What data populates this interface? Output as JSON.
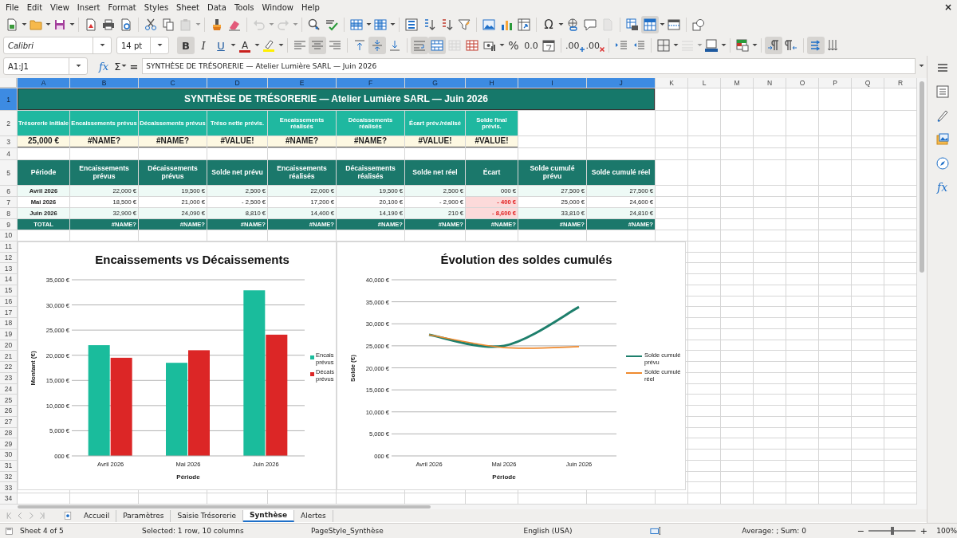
{
  "menu": [
    "File",
    "Edit",
    "View",
    "Insert",
    "Format",
    "Styles",
    "Sheet",
    "Data",
    "Tools",
    "Window",
    "Help"
  ],
  "close_label": "×",
  "toolbar": [
    {
      "kind": "new",
      "dropdown": true
    },
    {
      "kind": "open",
      "dropdown": true
    },
    {
      "kind": "save",
      "dropdown": true
    },
    {
      "kind": "sep"
    },
    {
      "kind": "pdf"
    },
    {
      "kind": "print"
    },
    {
      "kind": "preview"
    },
    {
      "kind": "sep"
    },
    {
      "kind": "cut"
    },
    {
      "kind": "copy"
    },
    {
      "kind": "paste",
      "dropdown": true,
      "disabled": true
    },
    {
      "kind": "sep"
    },
    {
      "kind": "clone"
    },
    {
      "kind": "clearformat"
    },
    {
      "kind": "sep"
    },
    {
      "kind": "undo",
      "dropdown": true,
      "disabled": true
    },
    {
      "kind": "redo",
      "dropdown": true,
      "disabled": true
    },
    {
      "kind": "sep"
    },
    {
      "kind": "findreplace"
    },
    {
      "kind": "spelling"
    },
    {
      "kind": "sep"
    },
    {
      "kind": "row",
      "dropdown": true
    },
    {
      "kind": "column",
      "dropdown": true
    },
    {
      "kind": "sep"
    },
    {
      "kind": "sort"
    },
    {
      "kind": "sortasc"
    },
    {
      "kind": "sortdesc"
    },
    {
      "kind": "filter"
    },
    {
      "kind": "sep"
    },
    {
      "kind": "image"
    },
    {
      "kind": "chart"
    },
    {
      "kind": "pivot"
    },
    {
      "kind": "sep"
    },
    {
      "kind": "special",
      "label": "Ω",
      "dropdown": true
    },
    {
      "kind": "hyperlink"
    },
    {
      "kind": "comment"
    },
    {
      "kind": "header",
      "disabled": true
    },
    {
      "kind": "sep"
    },
    {
      "kind": "printarea"
    },
    {
      "kind": "freeze",
      "dropdown": true,
      "pressed": true
    },
    {
      "kind": "split"
    },
    {
      "kind": "sep"
    },
    {
      "kind": "shapes"
    }
  ],
  "font_name": "Calibri",
  "font_size": "14 pt",
  "format_toolbar": [
    {
      "kind": "bold",
      "label": "B",
      "pressed": true
    },
    {
      "kind": "italic",
      "label": "I",
      "pressed": false
    },
    {
      "kind": "underline",
      "label": "U",
      "pressed": false,
      "dropdown": true
    },
    {
      "kind": "fontcolor",
      "label": "A",
      "dropdown": true
    },
    {
      "kind": "highlight",
      "dropdown": true
    },
    {
      "kind": "sep"
    },
    {
      "kind": "alignleft",
      "pressed": false
    },
    {
      "kind": "aligncenter",
      "pressed": true
    },
    {
      "kind": "alignright",
      "pressed": false
    },
    {
      "kind": "sep"
    },
    {
      "kind": "aligntop",
      "pressed": false
    },
    {
      "kind": "alignmiddle",
      "pressed": true
    },
    {
      "kind": "alignbottom",
      "pressed": false
    },
    {
      "kind": "sep"
    },
    {
      "kind": "wrap",
      "pressed": true
    },
    {
      "kind": "merge",
      "pressed": true
    },
    {
      "kind": "unmerge",
      "pressed": false,
      "disabled": true
    },
    {
      "kind": "cellborders",
      "pressed": false
    },
    {
      "kind": "currency",
      "dropdown": true
    },
    {
      "kind": "percent",
      "label": "%"
    },
    {
      "kind": "number",
      "label": "0.0"
    },
    {
      "kind": "date"
    },
    {
      "kind": "sep"
    },
    {
      "kind": "adddecimal",
      "label": ".00"
    },
    {
      "kind": "deldecimal",
      "label": ".00"
    },
    {
      "kind": "sep"
    },
    {
      "kind": "indent"
    },
    {
      "kind": "outdent"
    },
    {
      "kind": "sep"
    },
    {
      "kind": "borders",
      "dropdown": true
    },
    {
      "kind": "borderstyle",
      "dropdown": true,
      "disabled": true
    },
    {
      "kind": "bordercolor",
      "dropdown": true
    },
    {
      "kind": "sep"
    },
    {
      "kind": "conditional",
      "dropdown": true
    },
    {
      "kind": "sep"
    },
    {
      "kind": "ltr",
      "pressed": true
    },
    {
      "kind": "rtl",
      "pressed": false
    },
    {
      "kind": "sep"
    },
    {
      "kind": "textdirection",
      "pressed": true
    },
    {
      "kind": "vertical",
      "pressed": false
    }
  ],
  "formula_bar": {
    "name_box": "A1:J1",
    "function_wizard": "fx",
    "sum": "Σ",
    "equals": "=",
    "formula": "SYNTHÈSE DE TRÉSORERIE — Atelier Lumière SARL — Juin 2026"
  },
  "sheet": {
    "columns": [
      {
        "label": "A",
        "selected": true
      },
      {
        "label": "B",
        "selected": true
      },
      {
        "label": "C",
        "selected": true
      },
      {
        "label": "D",
        "selected": true
      },
      {
        "label": "E",
        "selected": true
      },
      {
        "label": "F",
        "selected": true
      },
      {
        "label": "G",
        "selected": true
      },
      {
        "label": "H",
        "selected": true
      },
      {
        "label": "I",
        "selected": true
      },
      {
        "label": "J",
        "selected": true
      },
      {
        "label": "K",
        "selected": false
      },
      {
        "label": "L",
        "selected": false
      },
      {
        "label": "M",
        "selected": false
      },
      {
        "label": "N",
        "selected": false
      },
      {
        "label": "O",
        "selected": false
      },
      {
        "label": "P",
        "selected": false
      },
      {
        "label": "Q",
        "selected": false
      },
      {
        "label": "R",
        "selected": false
      }
    ],
    "rows": [
      {
        "label": "1",
        "selected": true
      },
      {
        "label": "2",
        "selected": false
      },
      {
        "label": "3",
        "selected": false
      },
      {
        "label": "4",
        "selected": false
      },
      {
        "label": "5",
        "selected": false
      },
      {
        "label": "6",
        "selected": false
      },
      {
        "label": "7",
        "selected": false
      },
      {
        "label": "8",
        "selected": false
      },
      {
        "label": "9",
        "selected": false
      },
      {
        "label": "10",
        "selected": false
      },
      {
        "label": "11",
        "selected": false
      },
      {
        "label": "12",
        "selected": false
      },
      {
        "label": "13",
        "selected": false
      },
      {
        "label": "14",
        "selected": false
      },
      {
        "label": "15",
        "selected": false
      },
      {
        "label": "16",
        "selected": false
      },
      {
        "label": "17",
        "selected": false
      },
      {
        "label": "18",
        "selected": false
      },
      {
        "label": "19",
        "selected": false
      },
      {
        "label": "20",
        "selected": false
      },
      {
        "label": "21",
        "selected": false
      },
      {
        "label": "22",
        "selected": false
      },
      {
        "label": "23",
        "selected": false
      },
      {
        "label": "24",
        "selected": false
      },
      {
        "label": "25",
        "selected": false
      },
      {
        "label": "26",
        "selected": false
      },
      {
        "label": "27",
        "selected": false
      },
      {
        "label": "28",
        "selected": false
      },
      {
        "label": "29",
        "selected": false
      },
      {
        "label": "30",
        "selected": false
      },
      {
        "label": "31",
        "selected": false
      },
      {
        "label": "32",
        "selected": false
      },
      {
        "label": "33",
        "selected": false
      },
      {
        "label": "34",
        "selected": false
      }
    ],
    "title": "SYNTHÈSE DE TRÉSORERIE — Atelier Lumière SARL — Juin 2026",
    "kpi_headers": [
      "Trésorerie initiale",
      "Encaissements prévus",
      "Décaissements prévus",
      "Tréso nette prévis.",
      "Encaissements réalisés",
      "Décaissements réalisés",
      "Écart prév./réalisé",
      "Solde final prévis."
    ],
    "kpi_values": [
      "25,000 €",
      "#NAME?",
      "#NAME?",
      "#VALUE!",
      "#NAME?",
      "#NAME?",
      "#VALUE!",
      "#VALUE!"
    ],
    "table_columns": [
      "Période",
      "Encaissements prévus",
      "Décaissements prévus",
      "Solde net prévu",
      "Encaissements réalisés",
      "Décaissements réalisés",
      "Solde net réel",
      "Écart",
      "Solde cumulé prévu",
      "Solde cumulé réel"
    ],
    "table_rows": [
      {
        "cells": [
          "Avril 2026",
          "22,000 €",
          "19,500 €",
          "2,500 €",
          "22,000 €",
          "19,500 €",
          "2,500 €",
          "000 €",
          "27,500 €",
          "27,500 €"
        ],
        "alert": false
      },
      {
        "cells": [
          "Mai 2026",
          "18,500 €",
          "21,000 €",
          "- 2,500 €",
          "17,200 €",
          "20,100 €",
          "- 2,900 €",
          "- 400 €",
          "25,000 €",
          "24,600 €"
        ],
        "alert": true
      },
      {
        "cells": [
          "Juin 2026",
          "32,900 €",
          "24,090 €",
          "8,810 €",
          "14,400 €",
          "14,190 €",
          "210 €",
          "- 8,600 €",
          "33,810 €",
          "24,810 €"
        ],
        "alert": true
      }
    ],
    "total_row": [
      "TOTAL",
      "#NAME?",
      "#NAME?",
      "#NAME?",
      "#NAME?",
      "#NAME?",
      "#NAME?",
      "#NAME?",
      "#NAME?",
      "#NAME?"
    ],
    "charts": [
      {
        "chart_data": {
          "type": "bar",
          "title": "Encaissements vs Décaissements",
          "xlabel": "Période",
          "ylabel": "Montant (€)",
          "categories": [
            "Avril 2026",
            "Mai 2026",
            "Juin 2026"
          ],
          "series": [
            {
              "name": "Encais prévus",
              "color": "#1abc9c",
              "values": [
                22000,
                18500,
                32900
              ]
            },
            {
              "name": "Décais prévus",
              "color": "#dc2626",
              "values": [
                19500,
                21000,
                24090
              ]
            }
          ],
          "grid": true,
          "legend": "right",
          "ylim": [
            0,
            35000
          ],
          "yticks": [
            {
              "value": 0,
              "label": "000 €"
            },
            {
              "value": 5000,
              "label": "5,000 €"
            },
            {
              "value": 10000,
              "label": "10,000 €"
            },
            {
              "value": 15000,
              "label": "15,000 €"
            },
            {
              "value": 20000,
              "label": "20,000 €"
            },
            {
              "value": 25000,
              "label": "25,000 €"
            },
            {
              "value": 30000,
              "label": "30,000 €"
            },
            {
              "value": 35000,
              "label": "35,000 €"
            }
          ]
        }
      },
      {
        "chart_data": {
          "type": "line",
          "title": "Évolution des soldes cumulés",
          "xlabel": "Période",
          "ylabel": "Solde (€)",
          "categories": [
            "Avril 2026",
            "Mai 2026",
            "Juin 2026"
          ],
          "series": [
            {
              "name": "Solde cumulé prévu",
              "color": "#1e7f6c",
              "values": [
                27500,
                25000,
                33810
              ]
            },
            {
              "name": "Solde cumulé réel",
              "color": "#ef8a2f",
              "values": [
                27500,
                24600,
                24810
              ]
            }
          ],
          "grid": true,
          "legend": "right",
          "ylim": [
            0,
            40000
          ],
          "yticks": [
            {
              "value": 0,
              "label": "000 €"
            },
            {
              "value": 5000,
              "label": "5,000 €"
            },
            {
              "value": 10000,
              "label": "10,000 €"
            },
            {
              "value": 15000,
              "label": "15,000 €"
            },
            {
              "value": 20000,
              "label": "20,000 €"
            },
            {
              "value": 25000,
              "label": "25,000 €"
            },
            {
              "value": 30000,
              "label": "30,000 €"
            },
            {
              "value": 35000,
              "label": "35,000 €"
            },
            {
              "value": 40000,
              "label": "40,000 €"
            }
          ]
        }
      }
    ]
  },
  "sheet_tabs": [
    {
      "label": "Accueil",
      "selected": false
    },
    {
      "label": "Paramètres",
      "selected": false
    },
    {
      "label": "Saisie Trésorerie",
      "selected": false
    },
    {
      "label": "Synthèse",
      "selected": true
    },
    {
      "label": "Alertes",
      "selected": false
    }
  ],
  "status_bar": {
    "sheet": "Sheet 4 of 5",
    "selection": "Selected: 1 row, 10 columns",
    "page_style": "PageStyle_Synthèse",
    "language": "English (USA)",
    "summary": "Average: ; Sum: 0",
    "zoom_minus": "−",
    "zoom_plus": "+",
    "zoom_slider": {
      "level": 0.5
    },
    "zoom": "100%"
  },
  "sidebar": [
    {
      "kind": "properties"
    },
    {
      "kind": "styles"
    },
    {
      "kind": "gallery"
    },
    {
      "kind": "navigator"
    },
    {
      "kind": "functions",
      "label": "fx"
    }
  ]
}
